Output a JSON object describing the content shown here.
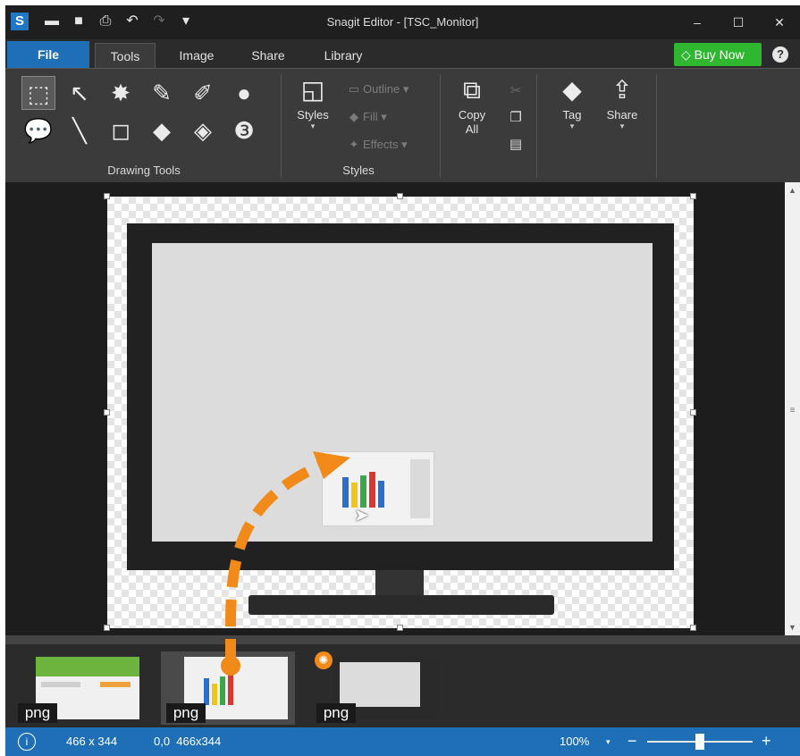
{
  "window": {
    "title": "Snagit Editor - [TSC_Monitor]",
    "app_icon_letter": "S",
    "quick_access": [
      "open-folder-icon",
      "save-icon",
      "print-icon",
      "undo-icon",
      "redo-icon",
      "customize-dropdown-icon"
    ],
    "controls": {
      "minimize": "–",
      "maximize": "☐",
      "close": "✕"
    }
  },
  "tabs": {
    "file": "File",
    "items": [
      "Tools",
      "Image",
      "Share",
      "Library"
    ],
    "active": "Tools",
    "buy_now": "Buy Now",
    "help": "?"
  },
  "ribbon": {
    "drawing_tools": {
      "label": "Drawing Tools",
      "tools": [
        "selection",
        "arrow",
        "stamp",
        "pen",
        "highlighter",
        "fill",
        "callout",
        "line",
        "shape",
        "fill-bucket",
        "eraser",
        "step"
      ]
    },
    "styles": {
      "label": "Styles",
      "styles_button": "Styles",
      "outline": "Outline",
      "fill": "Fill",
      "effects": "Effects"
    },
    "clipboard": {
      "copy_all_line1": "Copy",
      "copy_all_line2": "All"
    },
    "tag": "Tag",
    "share": "Share"
  },
  "canvas": {
    "image_name": "TSC_Monitor",
    "has_annotation_arrow": true
  },
  "tray": {
    "items": [
      {
        "type": "png",
        "selected": false
      },
      {
        "type": "png",
        "selected": true
      },
      {
        "type": "png",
        "selected": false,
        "badge": true
      }
    ]
  },
  "status": {
    "dimensions": "466 x 344",
    "position": "0,0  466x344",
    "zoom": "100%",
    "zoom_minus": "−",
    "zoom_plus": "+"
  },
  "colors": {
    "accent_blue": "#1f6fb7",
    "buy_green": "#2fb82f",
    "arrow_orange": "#f28a1a",
    "dark_bg": "#2b2b2b"
  }
}
